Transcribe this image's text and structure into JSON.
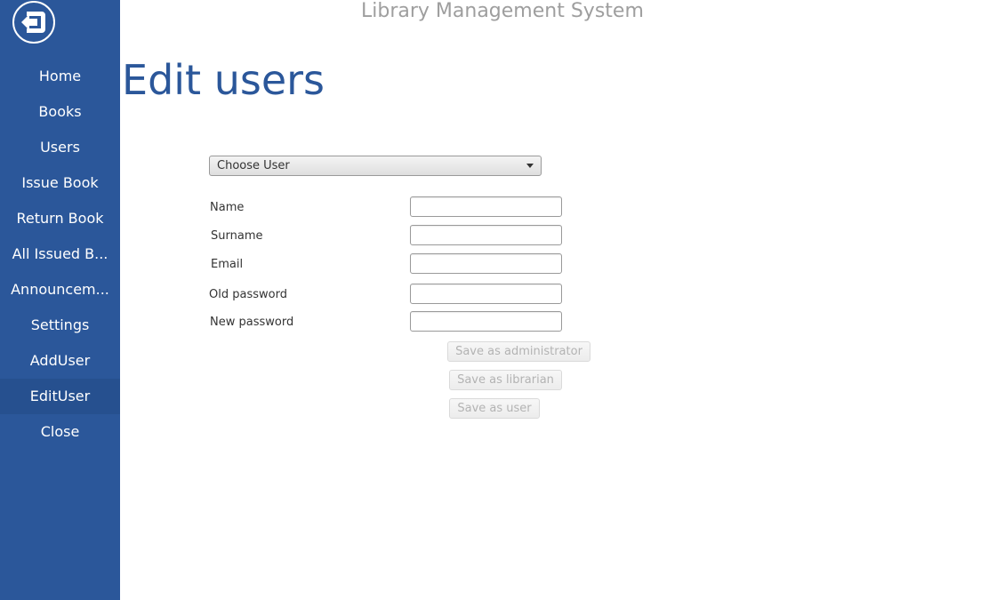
{
  "app": {
    "title": "Library Management System"
  },
  "sidebar": {
    "back_icon": "sign-out-icon",
    "items": [
      {
        "label": "Home"
      },
      {
        "label": "Books"
      },
      {
        "label": "Users"
      },
      {
        "label": "Issue Book"
      },
      {
        "label": "Return Book"
      },
      {
        "label": "All Issued B..."
      },
      {
        "label": "Announcem..."
      },
      {
        "label": "Settings"
      },
      {
        "label": "AddUser"
      },
      {
        "label": "EditUser",
        "active": true
      },
      {
        "label": "Close"
      }
    ],
    "bg_color": "#2b579a",
    "active_color": "#26508f"
  },
  "main": {
    "page_title": "Edit users",
    "user_select": {
      "value": "Choose User"
    },
    "fields": {
      "name": {
        "label": "Name",
        "value": ""
      },
      "surname": {
        "label": "Surname",
        "value": ""
      },
      "email": {
        "label": "Email",
        "value": ""
      },
      "old_password": {
        "label": "Old password",
        "value": ""
      },
      "new_password": {
        "label": "New password",
        "value": ""
      }
    },
    "buttons": {
      "save_admin": "Save as administrator",
      "save_librarian": "Save as librarian",
      "save_user": "Save as user"
    },
    "accent_color": "#2b579a"
  }
}
